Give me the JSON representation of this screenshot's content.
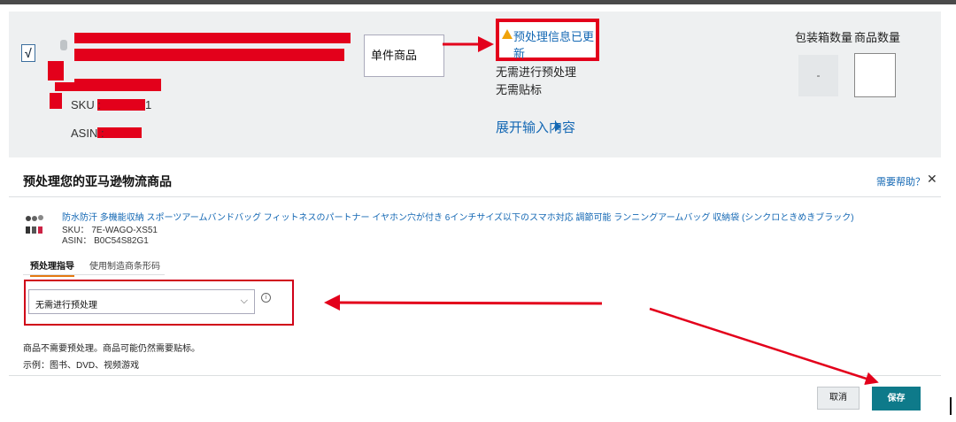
{
  "upper_row": {
    "checkbox_mark": "√",
    "sku_label": "SKU :",
    "sku_suffix": "1",
    "asin_label": "ASIN :",
    "condition_select": "单件商品",
    "prep_updated": "预处理信息已更新",
    "no_prep": "无需进行预处理",
    "no_label": "无需贴标",
    "expand_link": "展开输入内容",
    "col_box_qty": "包装箱数量",
    "col_item_qty": "商品数量",
    "box_qty_value": "-"
  },
  "dialog": {
    "title": "预处理您的亚马逊物流商品",
    "help": "需要帮助？",
    "close_icon": "close-icon",
    "product": {
      "title": "防水防汗 多機能収納 スポーツアームバンドバッグ フィットネスのパートナー イヤホン穴が付き 6インチサイズ以下のスマホ対応 調節可能 ランニングアームバッグ 収納袋 (シンクロときめきブラック)",
      "sku": "SKU：  7E-WAGO-XS51",
      "asin": "ASIN：  B0C54S82G1"
    },
    "tabs": [
      {
        "label": "预处理指导",
        "active": true
      },
      {
        "label": "使用制造商条形码",
        "active": false
      }
    ],
    "prep_select": {
      "value": "无需进行预处理",
      "chevron_icon": "chevron-down-icon",
      "info_icon": "info-icon"
    },
    "description_1": "商品不需要预处理。商品可能仍然需要贴标。",
    "description_2": "示例：图书、DVD、视频游戏",
    "cancel": "取消",
    "save": "保存"
  },
  "colors": {
    "highlight_red": "#e3001b",
    "link_blue": "#1468b4",
    "save_teal": "#0e7a8a",
    "panel_gray": "#eef0f1"
  }
}
